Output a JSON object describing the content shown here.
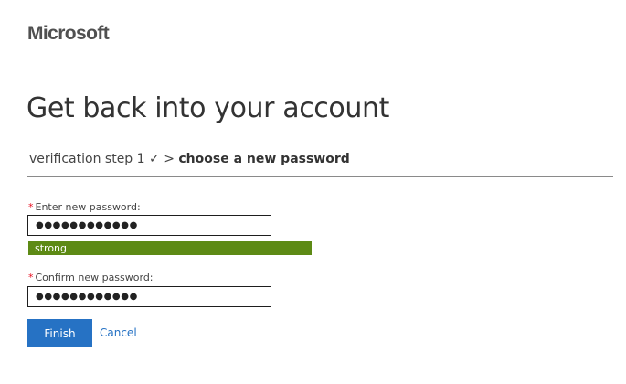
{
  "brand": {
    "name": "Microsoft"
  },
  "page": {
    "title": "Get back into your account"
  },
  "breadcrumb": {
    "step": "verification step 1",
    "checkmark": "✓",
    "separator": ">",
    "current": "choose a new password"
  },
  "form": {
    "required_marker": "*",
    "new_password": {
      "label": "Enter new password:",
      "masked_value": "●●●●●●●●●●●●"
    },
    "strength": {
      "label": "strong",
      "color": "#5d8a15"
    },
    "confirm_password": {
      "label": "Confirm new password:",
      "masked_value": "●●●●●●●●●●●●"
    }
  },
  "actions": {
    "finish_label": "Finish",
    "cancel_label": "Cancel",
    "accent_color": "#2672c4"
  }
}
